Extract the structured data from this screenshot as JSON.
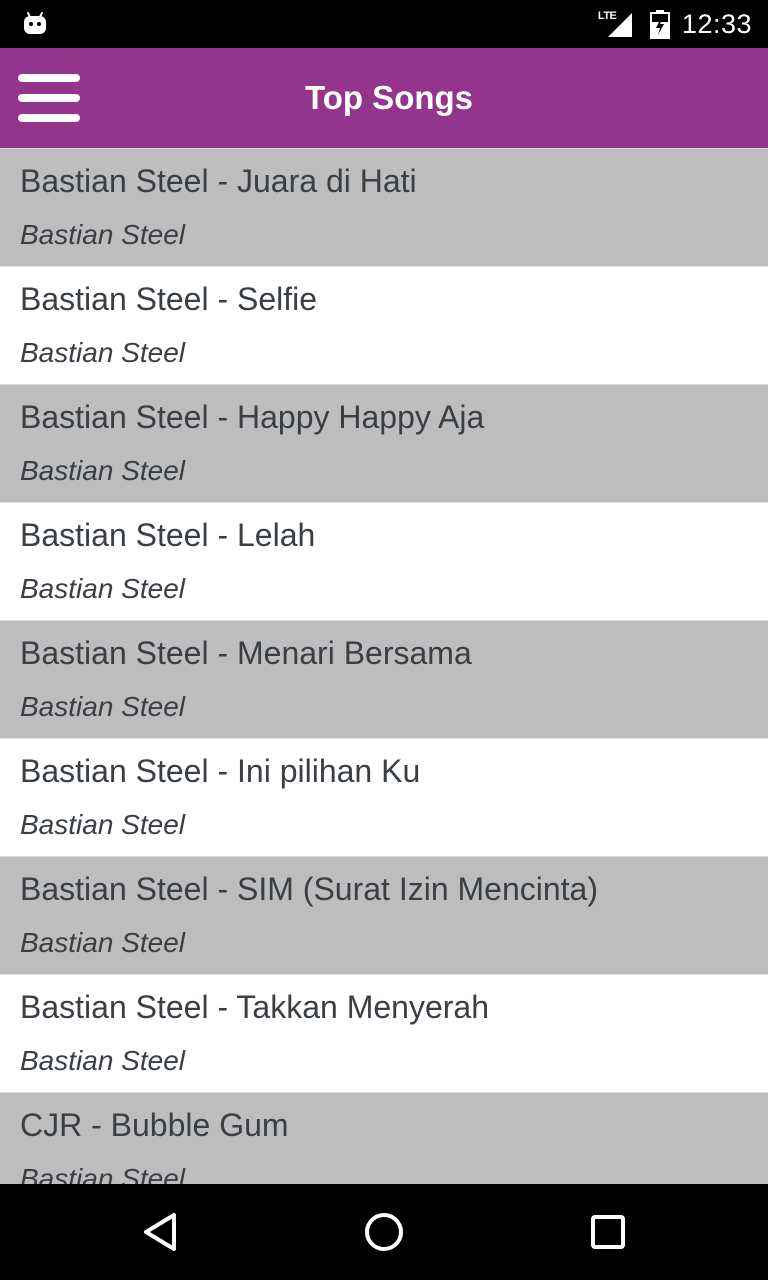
{
  "status_bar": {
    "notification_icon": "android-icon",
    "network_label": "LTE",
    "signal_icon": "signal-icon",
    "battery_icon": "battery-icon",
    "time": "12:33"
  },
  "app_bar": {
    "menu_icon": "hamburger-menu-icon",
    "title": "Top Songs",
    "color": "#93358d"
  },
  "songs": [
    {
      "title": "Bastian Steel - Juara di Hati",
      "artist": "Bastian Steel"
    },
    {
      "title": "Bastian Steel - Selfie",
      "artist": "Bastian Steel"
    },
    {
      "title": "Bastian Steel - Happy Happy Aja",
      "artist": "Bastian Steel"
    },
    {
      "title": "Bastian Steel - Lelah",
      "artist": "Bastian Steel"
    },
    {
      "title": "Bastian Steel - Menari Bersama",
      "artist": "Bastian Steel"
    },
    {
      "title": "Bastian Steel - Ini pilihan Ku",
      "artist": "Bastian Steel"
    },
    {
      "title": "Bastian Steel - SIM (Surat Izin Mencinta)",
      "artist": "Bastian Steel"
    },
    {
      "title": "Bastian Steel - Takkan Menyerah",
      "artist": "Bastian Steel"
    },
    {
      "title": "CJR - Bubble Gum",
      "artist": "Bastian Steel"
    }
  ],
  "colors": {
    "row_shaded": "#bdbdbd",
    "row_plain": "#ffffff",
    "text": "#3a3f45"
  },
  "nav_bar": {
    "back_icon": "back-triangle-icon",
    "home_icon": "home-circle-icon",
    "recents_icon": "recents-square-icon"
  }
}
